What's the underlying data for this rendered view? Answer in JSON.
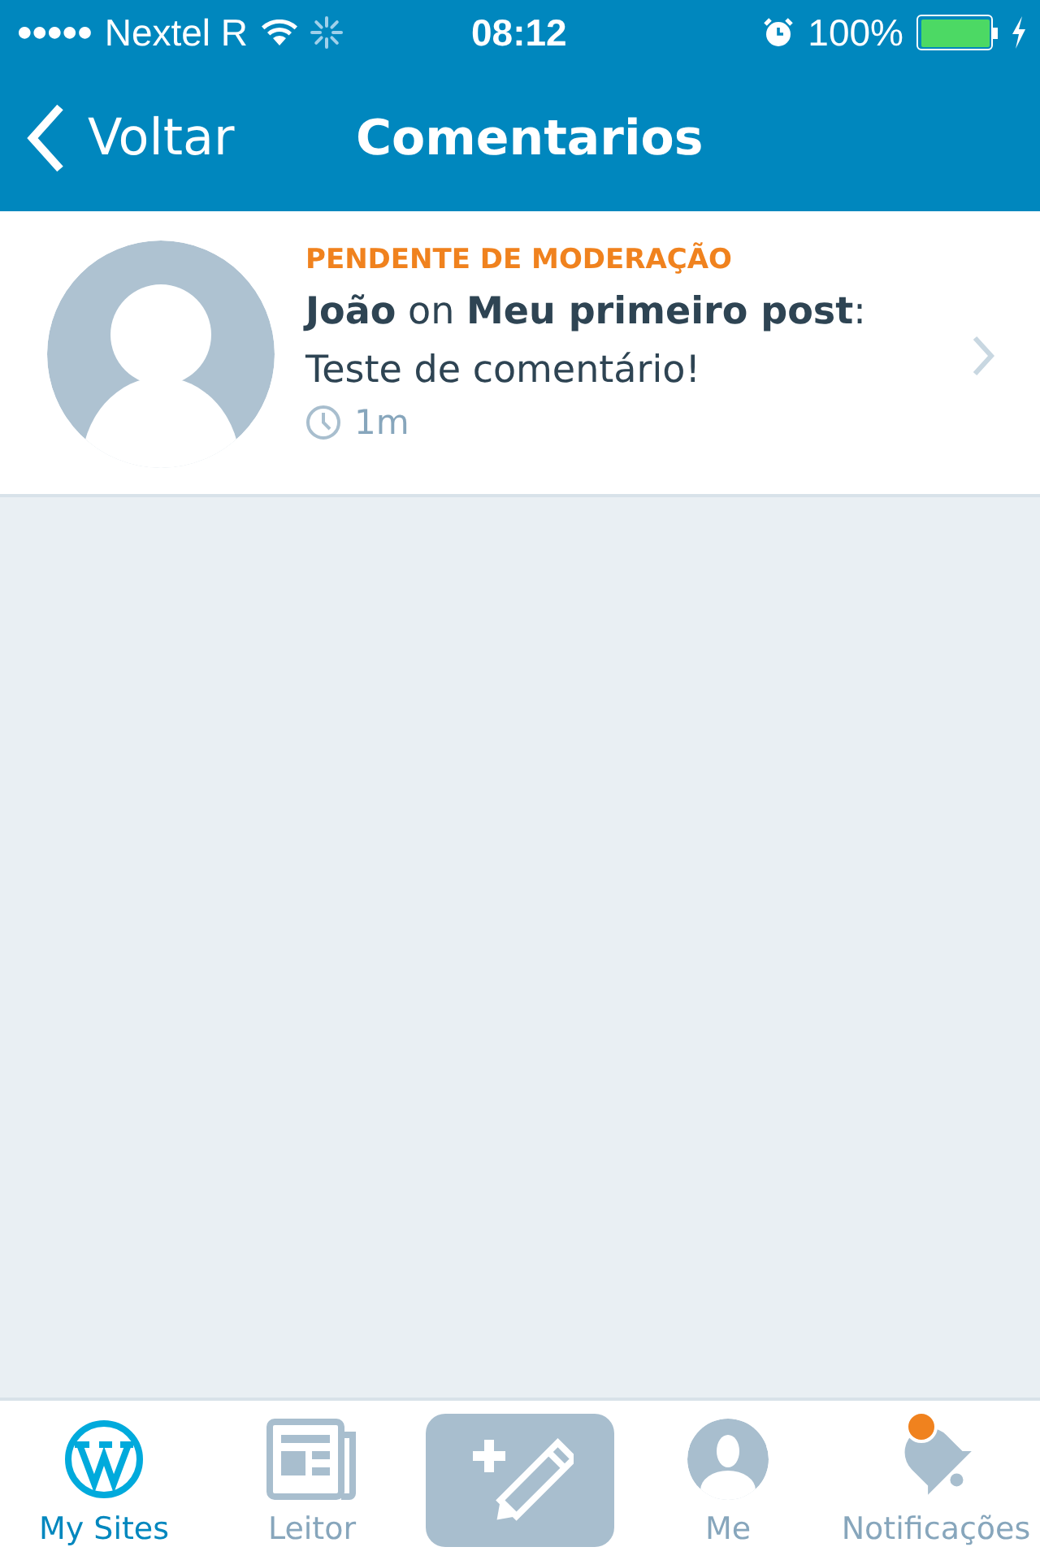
{
  "status_bar": {
    "carrier": "Nextel R",
    "signal_dots": "●●●●●",
    "time": "08:12",
    "battery": "100%",
    "charging": true
  },
  "nav_bar": {
    "back": "Voltar",
    "title": "Comentarios"
  },
  "comments": [
    {
      "status": "PENDENTE DE MODERAÇÃO",
      "author": "João",
      "connector": "on",
      "post": "Meu primeiro post",
      "separator": ":",
      "text": "Teste de comentário!",
      "age": "1m"
    }
  ],
  "tab_bar": [
    {
      "label": "My Sites",
      "kind": "sites",
      "selected": true
    },
    {
      "label": "Leitor",
      "kind": "reader",
      "selected": false
    },
    {
      "kind": "compose",
      "selected": false
    },
    {
      "label": "Me",
      "kind": "me",
      "selected": false
    },
    {
      "label": "Notificações",
      "kind": "notifications",
      "selected": false,
      "badge": true
    }
  ]
}
